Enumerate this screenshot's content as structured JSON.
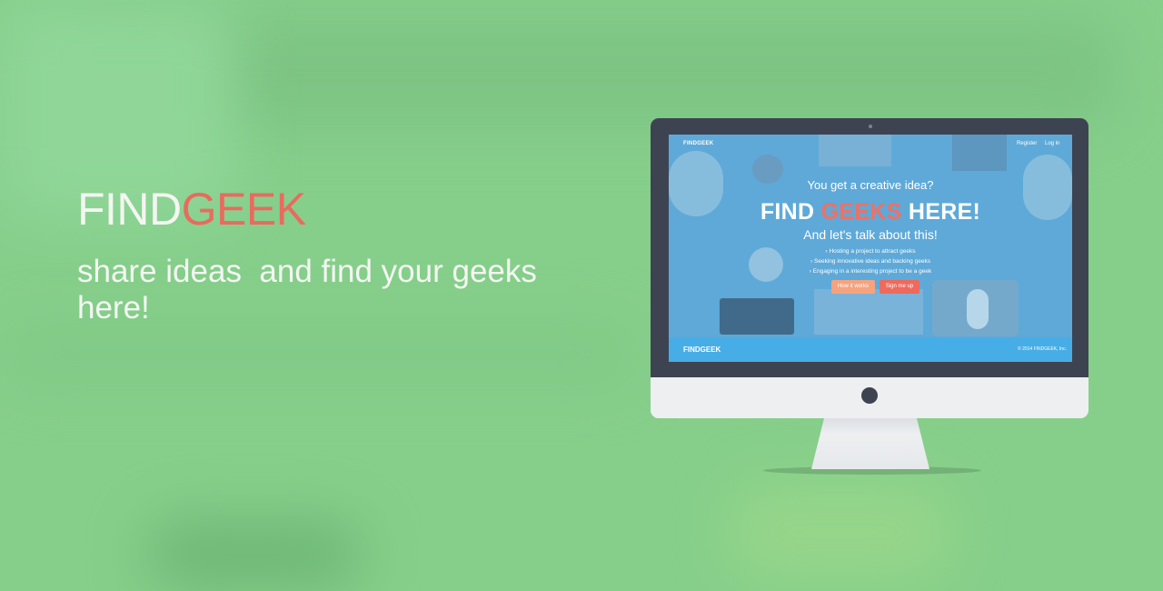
{
  "hero": {
    "title_part1": "FIND",
    "title_part2": "GEEK",
    "subtitle": "share ideas  and find your geeks here!"
  },
  "screen": {
    "brand": "FINDGEEK",
    "nav_register": "Register",
    "nav_login": "Log in",
    "question": "You get a creative idea?",
    "headline_part1": "FIND ",
    "headline_part2": "GEEKS",
    "headline_part3": " HERE!",
    "talk": "And let's talk about this!",
    "bullets": [
      "› Hosting a project to attract geeks",
      "› Seeking innovative ideas and backing geeks",
      "› Engaging in a interesting project to be a geek"
    ],
    "btn_how": "How it works",
    "btn_sign": "Sign me up",
    "footer_brand": "FINDGEEK",
    "footer_copy": "© 2014 FINDGEEK, Inc."
  },
  "colors": {
    "background": "#86cf8b",
    "accent": "#ea6a5f",
    "screen_blue": "#5ea9d8",
    "footer_blue": "#47ade6",
    "bezel": "#3e4351"
  },
  "icons": [
    "apple-logo-icon",
    "camera-icon"
  ]
}
